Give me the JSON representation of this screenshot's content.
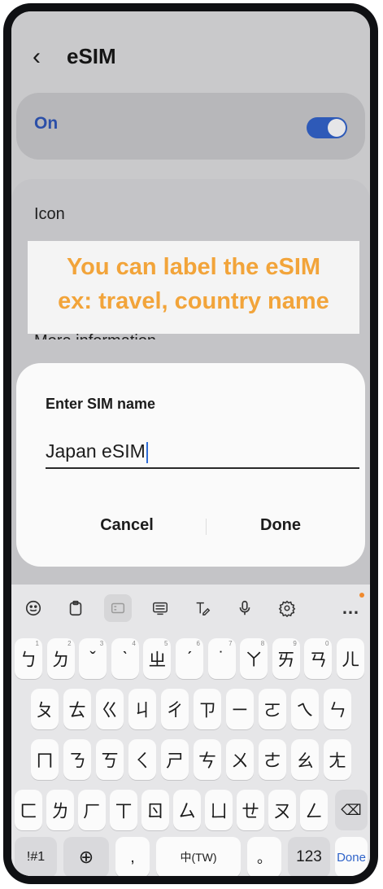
{
  "header": {
    "back_icon": "‹",
    "title": "eSIM"
  },
  "on_row": {
    "label": "On",
    "toggle_on": true
  },
  "settings": {
    "icon_label": "Icon",
    "more_info_label": "More information"
  },
  "banner": {
    "line1": "You can label the eSIM",
    "line2": "ex: travel, country name",
    "color": "#f2a43a"
  },
  "dialog": {
    "title": "Enter SIM name",
    "value": "Japan eSIM",
    "cancel_label": "Cancel",
    "done_label": "Done"
  },
  "keyboard": {
    "toolbar": [
      "emoji-icon",
      "clipboard-icon",
      "one-handed-icon",
      "keyboard-icon",
      "handwriting-icon",
      "microphone-icon",
      "settings-icon",
      "more-icon"
    ],
    "row1": [
      "ㄅ",
      "ㄉ",
      "ˇ",
      "ˋ",
      "ㄓ",
      "ˊ",
      "˙",
      "ㄚ",
      "ㄞ",
      "ㄢ",
      "ㄦ"
    ],
    "row1_small": [
      "1",
      "2",
      "3",
      "4",
      "5",
      "6",
      "7",
      "8",
      "9",
      "0",
      ""
    ],
    "row2": [
      "ㄆ",
      "ㄊ",
      "ㄍ",
      "ㄐ",
      "ㄔ",
      "ㄗ",
      "ㄧ",
      "ㄛ",
      "ㄟ",
      "ㄣ"
    ],
    "row3": [
      "ㄇ",
      "ㄋ",
      "ㄎ",
      "ㄑ",
      "ㄕ",
      "ㄘ",
      "ㄨ",
      "ㄜ",
      "ㄠ",
      "ㄤ"
    ],
    "row4": [
      "ㄈ",
      "ㄌ",
      "ㄏ",
      "ㄒ",
      "ㄖ",
      "ㄙ",
      "ㄩ",
      "ㄝ",
      "ㄡ",
      "ㄥ"
    ],
    "backspace_icon": "⌫",
    "symbols_label": "!#1",
    "globe_icon": "⊕",
    "comma_label": ",",
    "space_label": "中(TW)",
    "period_label": "。",
    "numbers_label": "123",
    "done_label": "Done"
  }
}
